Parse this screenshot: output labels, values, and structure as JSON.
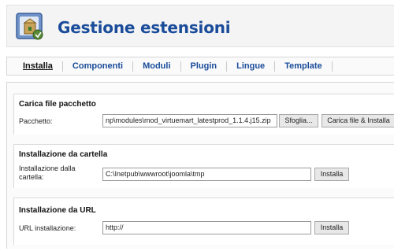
{
  "header": {
    "title": "Gestione estensioni",
    "icon": "extensions-package-icon"
  },
  "submenu": {
    "tabs": [
      {
        "label": "Installa",
        "active": true
      },
      {
        "label": "Componenti",
        "active": false
      },
      {
        "label": "Moduli",
        "active": false
      },
      {
        "label": "Plugin",
        "active": false
      },
      {
        "label": "Lingue",
        "active": false
      },
      {
        "label": "Template",
        "active": false
      }
    ]
  },
  "upload": {
    "title": "Carica file pacchetto",
    "label": "Pacchetto:",
    "value": "np\\modules\\mod_virtuemart_latestprod_1.1.4.j15.zip",
    "browse_label": "Sfoglia...",
    "submit_label": "Carica file & Installa"
  },
  "folder": {
    "title": "Installazione da cartella",
    "label": "Installazione dalla cartella:",
    "value": "C:\\Inetpub\\wwwroot\\joomla\\tmp",
    "submit_label": "Installa"
  },
  "url": {
    "title": "Installazione da URL",
    "label": "URL installazione:",
    "value": "http://",
    "submit_label": "Installa"
  },
  "colors": {
    "accent": "#1a4c9a",
    "header_bg": "#f4f4f4",
    "button_bg": "#e8e8e8"
  }
}
